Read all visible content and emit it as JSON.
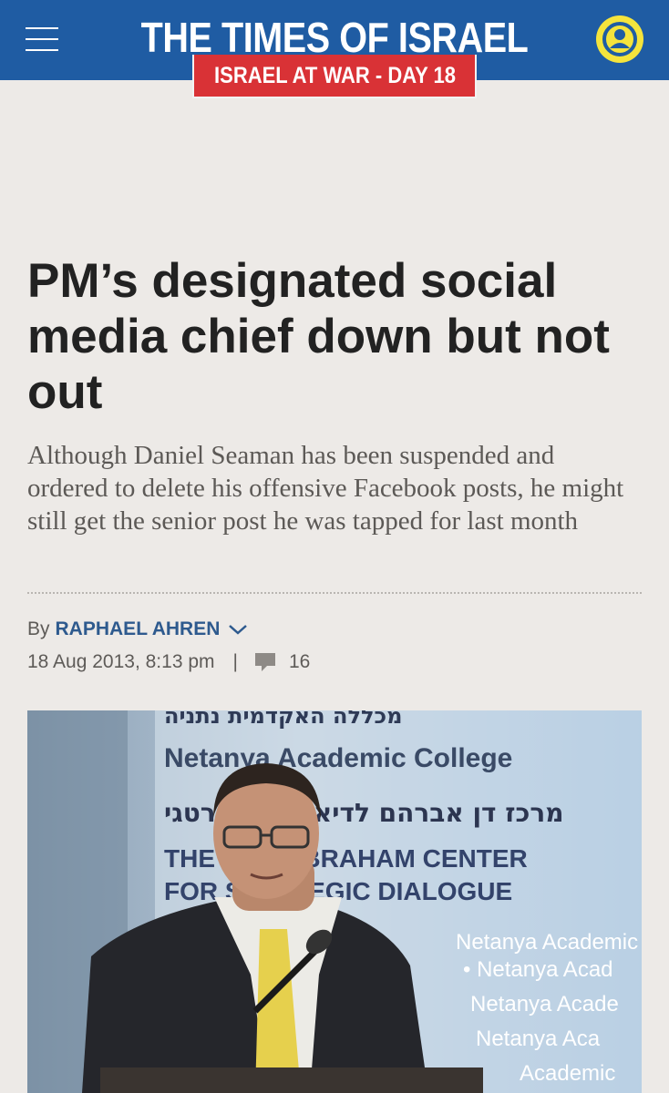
{
  "header": {
    "site_name": "THE TIMES OF ISRAEL",
    "banner": "ISRAEL AT WAR - DAY 18",
    "menu_icon": "hamburger-menu-icon",
    "account_icon": "user-account-icon",
    "colors": {
      "bar": "#1f5ca3",
      "banner": "#d93236",
      "account": "#f5e43c"
    }
  },
  "article": {
    "headline": "PM’s designated social media chief down but not out",
    "subhead": "Although Daniel Seaman has been suspended and ordered to delete his offensive Facebook posts, he might still get the senior post he was tapped for last month",
    "byline_prefix": "By",
    "author": "RAPHAEL AHREN",
    "timestamp": "18 Aug 2013, 8:13 pm",
    "separator": "|",
    "comment_count": "16"
  },
  "photo": {
    "backdrop_lines": [
      "מכללה האקדמית נתניה",
      "Netanya Academic College",
      "מרכז דן אברהם לדיאלוג אסטרטגי",
      "THE DAN ABRAHAM CENTER",
      "FOR STRATEGIC DIALOGUE",
      "Netanya Academic",
      "• Netanya Acad",
      "Netanya Acade",
      "Netanya Aca",
      "Academic"
    ]
  }
}
